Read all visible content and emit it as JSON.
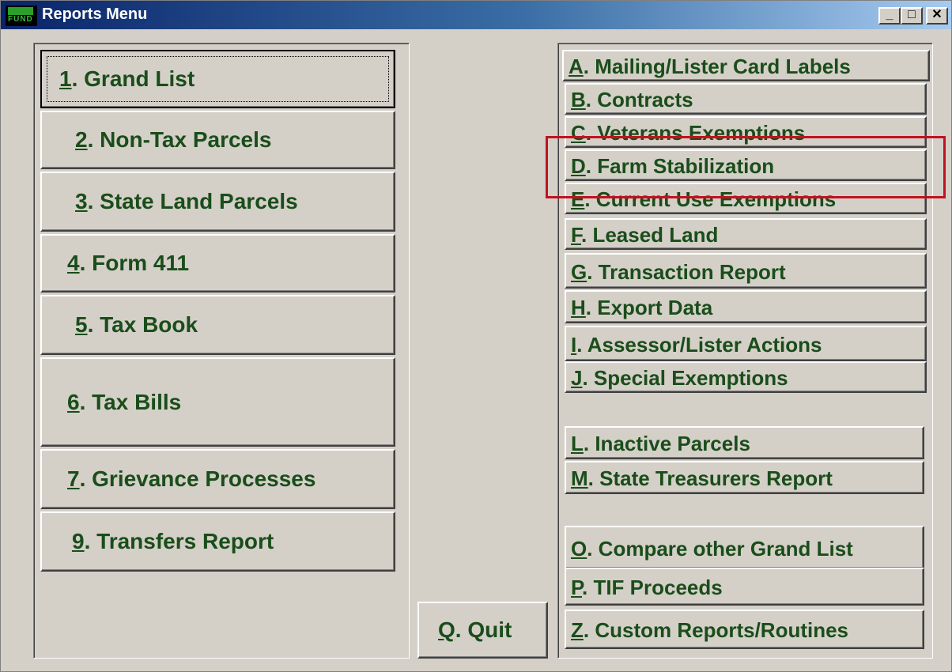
{
  "window": {
    "title": "Reports Menu",
    "icon_label": "FUND",
    "controls": {
      "minimize": "_",
      "maximize": "□",
      "close": "✕"
    }
  },
  "left_menu": [
    {
      "key": "1",
      "rest": ". Grand List"
    },
    {
      "key": "2",
      "rest": ". Non-Tax Parcels"
    },
    {
      "key": "3",
      "rest": ".  State Land Parcels"
    },
    {
      "key": "4",
      "rest": ". Form 411"
    },
    {
      "key": "5",
      "rest": ". Tax Book"
    },
    {
      "key": "6",
      "rest": ". Tax Bills"
    },
    {
      "key": "7",
      "rest": ". Grievance Processes"
    },
    {
      "key": "9",
      "rest": ". Transfers Report"
    }
  ],
  "quit": {
    "key": "Q",
    "rest": ".  Quit"
  },
  "right_menu": [
    {
      "key": "A",
      "rest": ". Mailing/Lister Card Labels"
    },
    {
      "key": "B",
      "rest": ". Contracts"
    },
    {
      "key": "C",
      "rest": ". Veterans Exemptions"
    },
    {
      "key": "D",
      "rest": ". Farm Stabilization"
    },
    {
      "key": "E",
      "rest": ". Current Use Exemptions"
    },
    {
      "key": "F",
      "rest": ". Leased Land"
    },
    {
      "key": "G",
      "rest": ". Transaction Report"
    },
    {
      "key": "H",
      "rest": ". Export Data"
    },
    {
      "key": "I",
      "rest": ". Assessor/Lister Actions"
    },
    {
      "key": "J",
      "rest": ". Special Exemptions"
    },
    {
      "key": "L",
      "rest": ". Inactive Parcels"
    },
    {
      "key": "M",
      "rest": ". State Treasurers Report"
    },
    {
      "key": "O",
      "rest": ".  Compare other Grand List"
    },
    {
      "key": "P",
      "rest": ". TIF Proceeds"
    },
    {
      "key": "Z",
      "rest": ". Custom Reports/Routines"
    }
  ],
  "colors": {
    "label_text": "#1a4d1a",
    "highlight_box": "#c1121f",
    "face": "#d4d0c8"
  }
}
